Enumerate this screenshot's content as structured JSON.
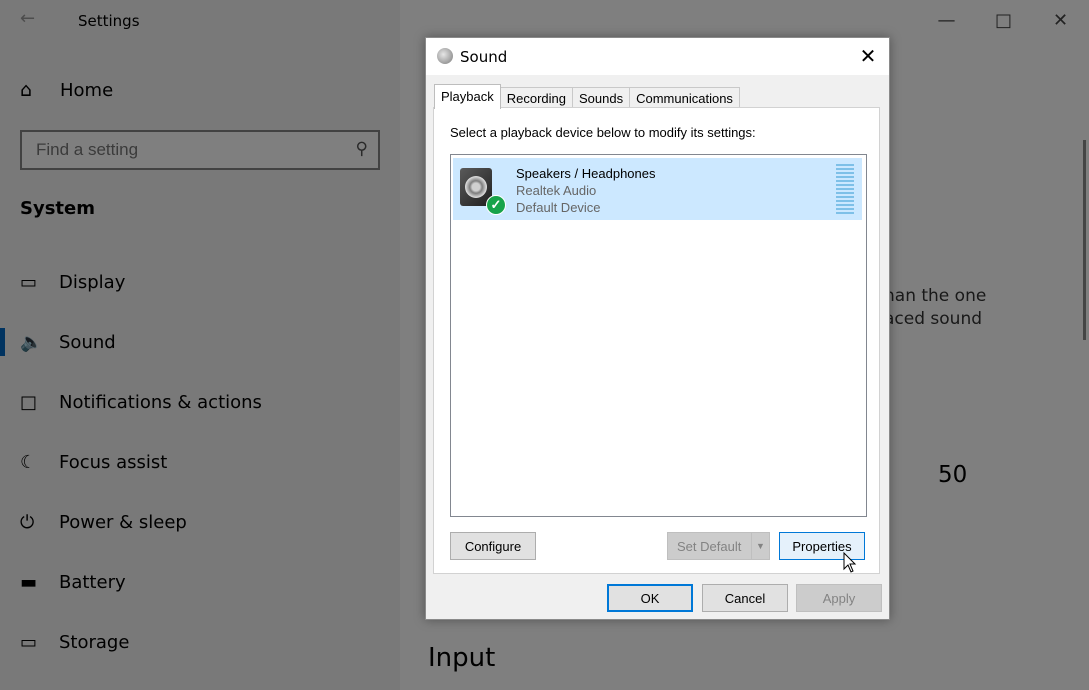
{
  "settings": {
    "title": "Settings",
    "home_label": "Home",
    "search_placeholder": "Find a setting",
    "section_label": "System",
    "nav_items": [
      {
        "label": "Display"
      },
      {
        "label": "Sound"
      },
      {
        "label": "Notifications & actions"
      },
      {
        "label": "Focus assist"
      },
      {
        "label": "Power & sleep"
      },
      {
        "label": "Battery"
      },
      {
        "label": "Storage"
      }
    ],
    "right_text_line1": "han the one",
    "right_text_line2": "aced sound",
    "right_value": "50",
    "right_heading": "Input"
  },
  "dialog": {
    "title": "Sound",
    "tabs": [
      "Playback",
      "Recording",
      "Sounds",
      "Communications"
    ],
    "active_tab": "Playback",
    "instructions": "Select a playback device below to modify its settings:",
    "device": {
      "name": "Speakers / Headphones",
      "driver": "Realtek Audio",
      "status": "Default Device"
    },
    "buttons": {
      "configure": "Configure",
      "set_default": "Set Default",
      "properties": "Properties",
      "ok": "OK",
      "cancel": "Cancel",
      "apply": "Apply"
    }
  },
  "colors": {
    "accent": "#0067c0",
    "selection": "#cce8ff",
    "default_check": "#17a34a"
  }
}
